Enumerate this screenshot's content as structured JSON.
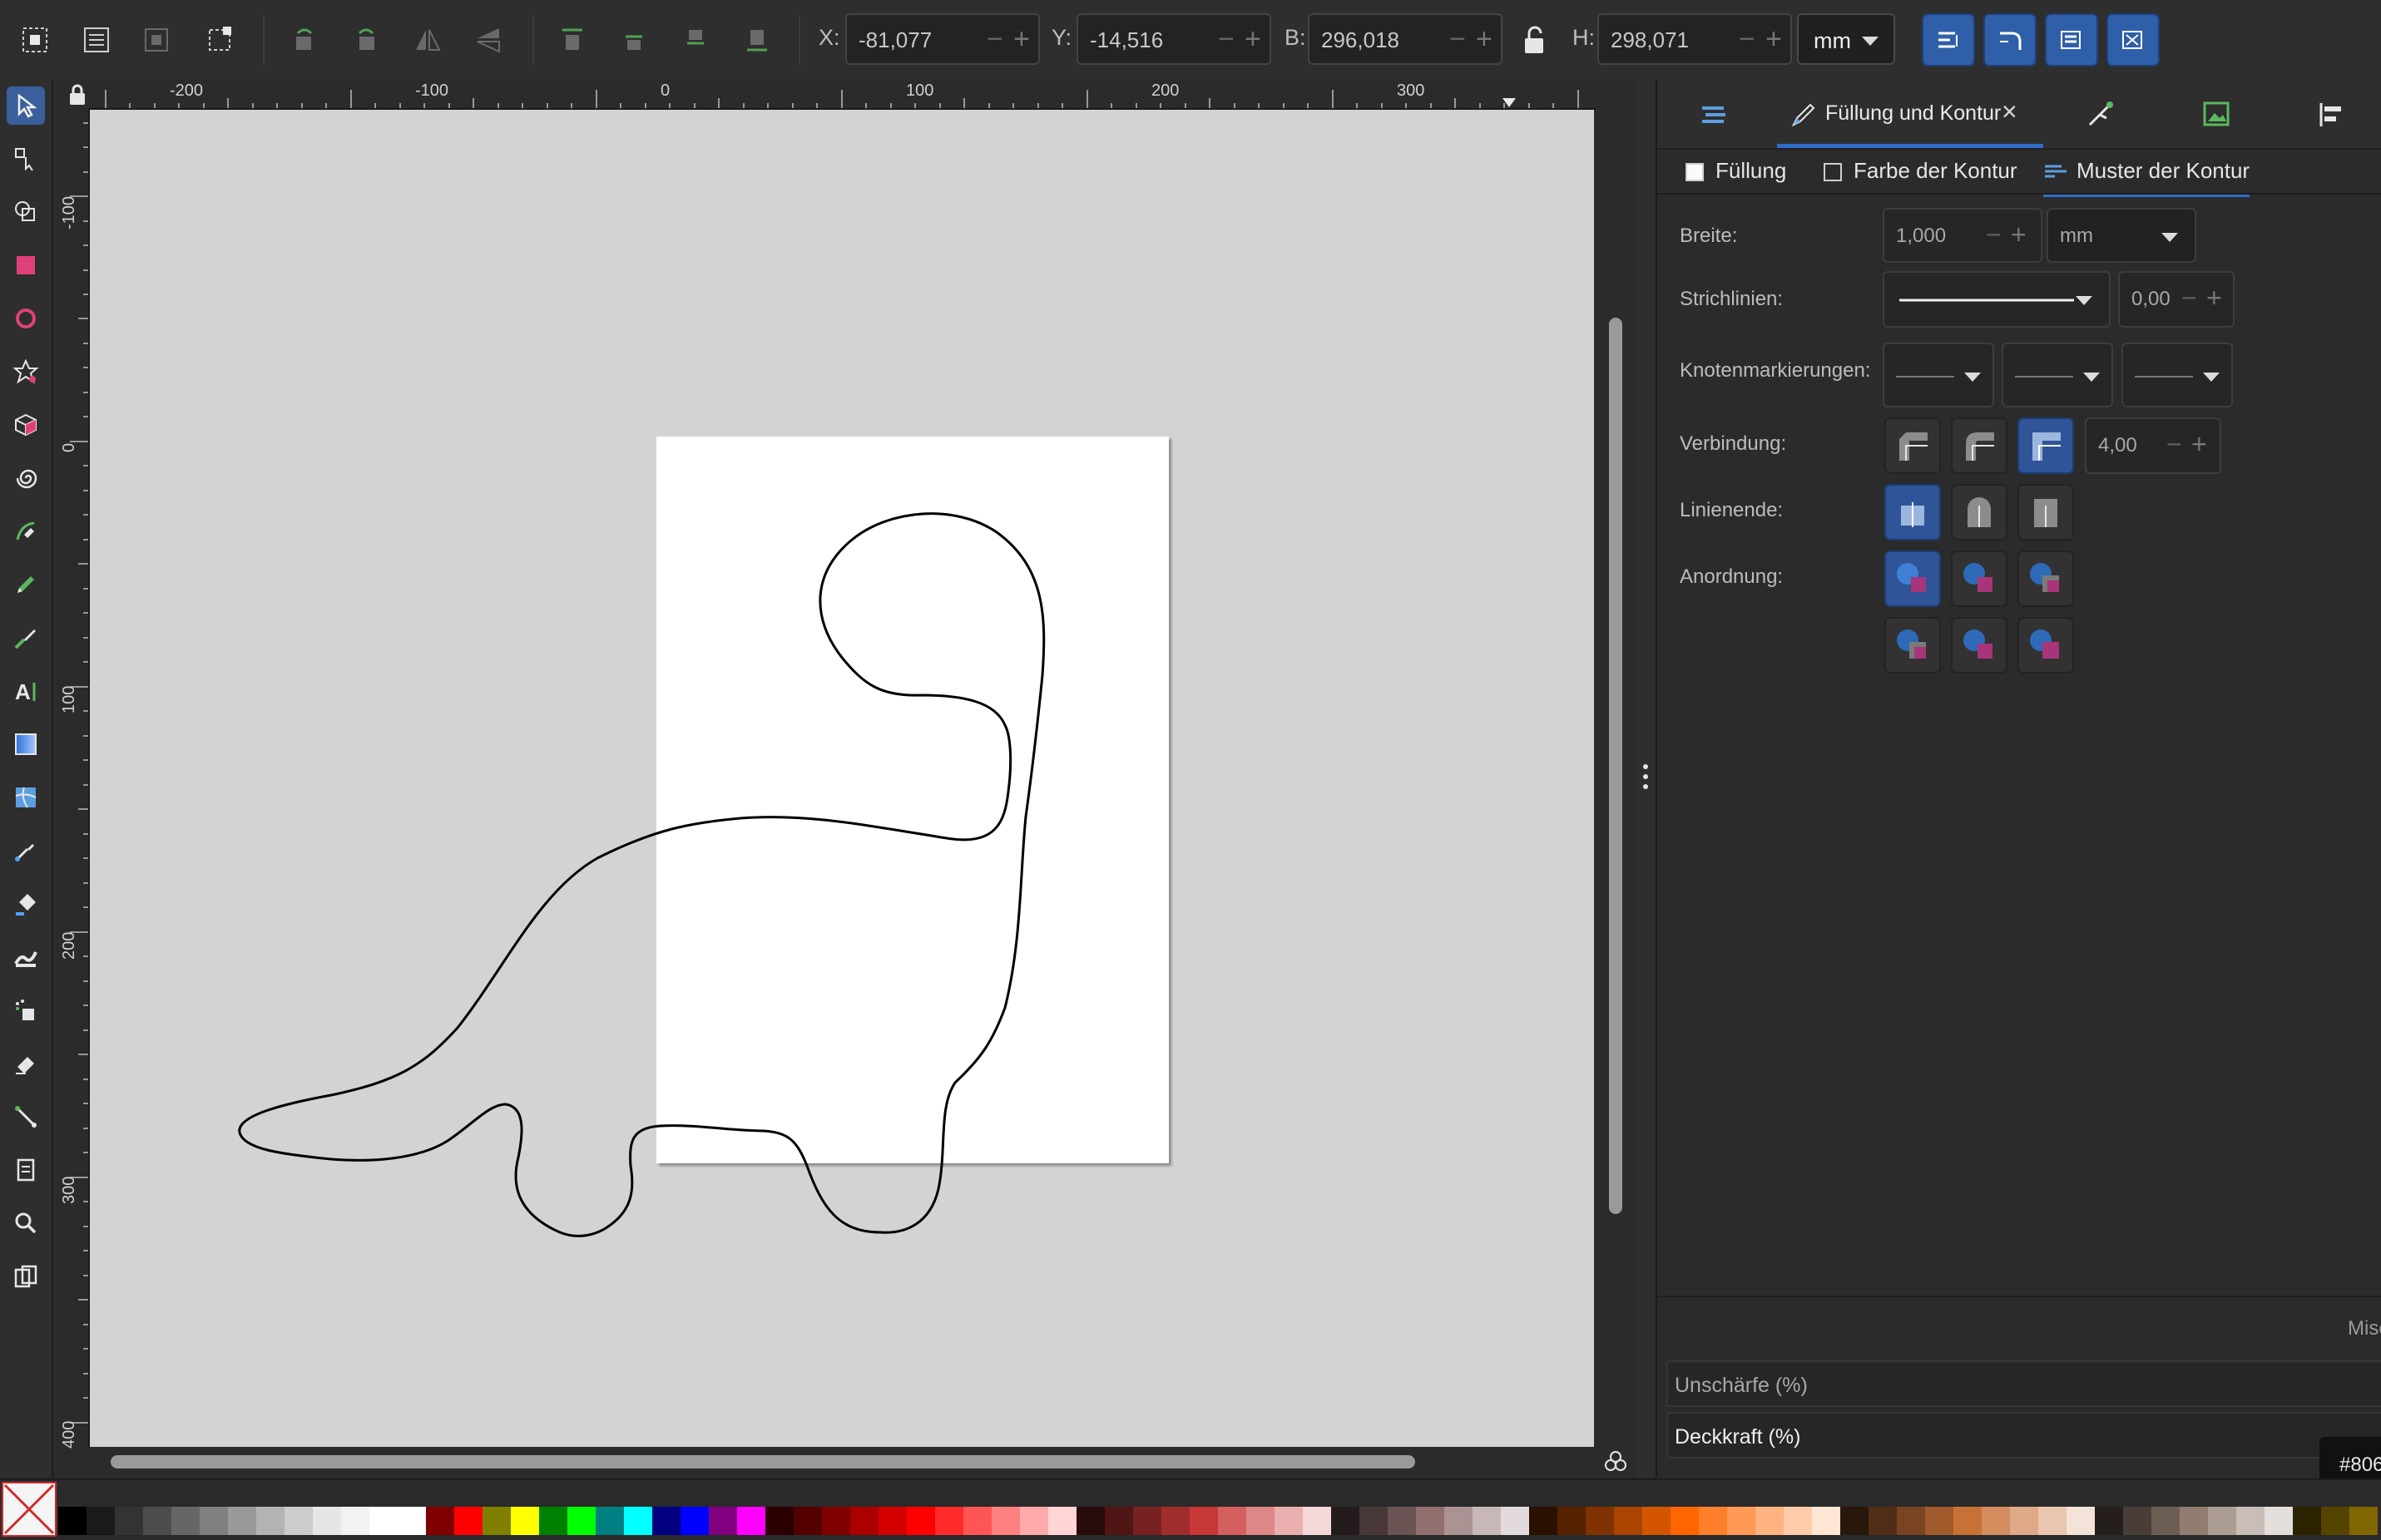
{
  "toolbar": {
    "x_label": "X:",
    "x_value": "-81,077",
    "y_label": "Y:",
    "y_value": "-14,516",
    "w_label": "B:",
    "w_value": "296,018",
    "h_label": "H:",
    "h_value": "298,071",
    "unit": "mm",
    "minus": "−",
    "plus": "+"
  },
  "rulers": {
    "horizontal": [
      "-200",
      "-100",
      "0",
      "100",
      "200",
      "300"
    ],
    "vertical": [
      "-100",
      "0",
      "100",
      "200",
      "300",
      "400"
    ]
  },
  "dock": {
    "active_tab_label": "Füllung und Kontur",
    "close_glyph": "×",
    "subtabs": {
      "fill": "Füllung",
      "stroke_paint": "Farbe der Kontur",
      "stroke_style": "Muster der Kontur"
    },
    "labels": {
      "width": "Breite:",
      "dashes": "Strichlinien:",
      "markers": "Knotenmarkierungen:",
      "join": "Verbindung:",
      "cap": "Linienende:",
      "order": "Anordnung:"
    },
    "width_value": "1,000",
    "width_unit": "mm",
    "dash_offset": "0,00",
    "miter_limit": "4,00",
    "blend_label": "Misc",
    "blur_label": "Unschärfe (%)",
    "opacity_label": "Deckkraft (%)"
  },
  "status": {
    "color_hex": "#806"
  },
  "colors": {
    "accent": "#2f5fa8",
    "swatches": [
      "#000000",
      "#1a1a1a",
      "#333333",
      "#4d4d4d",
      "#666666",
      "#808080",
      "#999999",
      "#b3b3b3",
      "#cccccc",
      "#e6e6e6",
      "#f2f2f2",
      "#ffffff",
      "#ffffff",
      "#800000",
      "#ff0000",
      "#808000",
      "#ffff00",
      "#008000",
      "#00ff00",
      "#008080",
      "#00ffff",
      "#000080",
      "#0000ff",
      "#800080",
      "#ff00ff",
      "#2b0000",
      "#550000",
      "#800000",
      "#aa0000",
      "#d40000",
      "#ff0000",
      "#ff2a2a",
      "#ff5555",
      "#ff8080",
      "#ffaaaa",
      "#ffd5d5",
      "#280b0b",
      "#501616",
      "#782121",
      "#a02c2c",
      "#c83737",
      "#d35f5f",
      "#de8787",
      "#e9afaf",
      "#f4d7d7",
      "#241c1c",
      "#483737",
      "#6c5353",
      "#916f6f",
      "#ac9393",
      "#c8b7b7",
      "#e3dbdb",
      "#2b1100",
      "#552200",
      "#803300",
      "#aa4400",
      "#d45500",
      "#ff6600",
      "#ff7f2a",
      "#ff9955",
      "#ffb380",
      "#ffccaa",
      "#ffe6d5",
      "#28170b",
      "#502d16",
      "#784421",
      "#a05a2c",
      "#c87137",
      "#d38d5f",
      "#deaa87",
      "#e9c6af",
      "#f4e3d7",
      "#241f1c",
      "#483e37",
      "#6c5d53",
      "#917c6f",
      "#ac9d93",
      "#c8beb7",
      "#e3dedb",
      "#2b2200",
      "#554400",
      "#806600"
    ]
  }
}
